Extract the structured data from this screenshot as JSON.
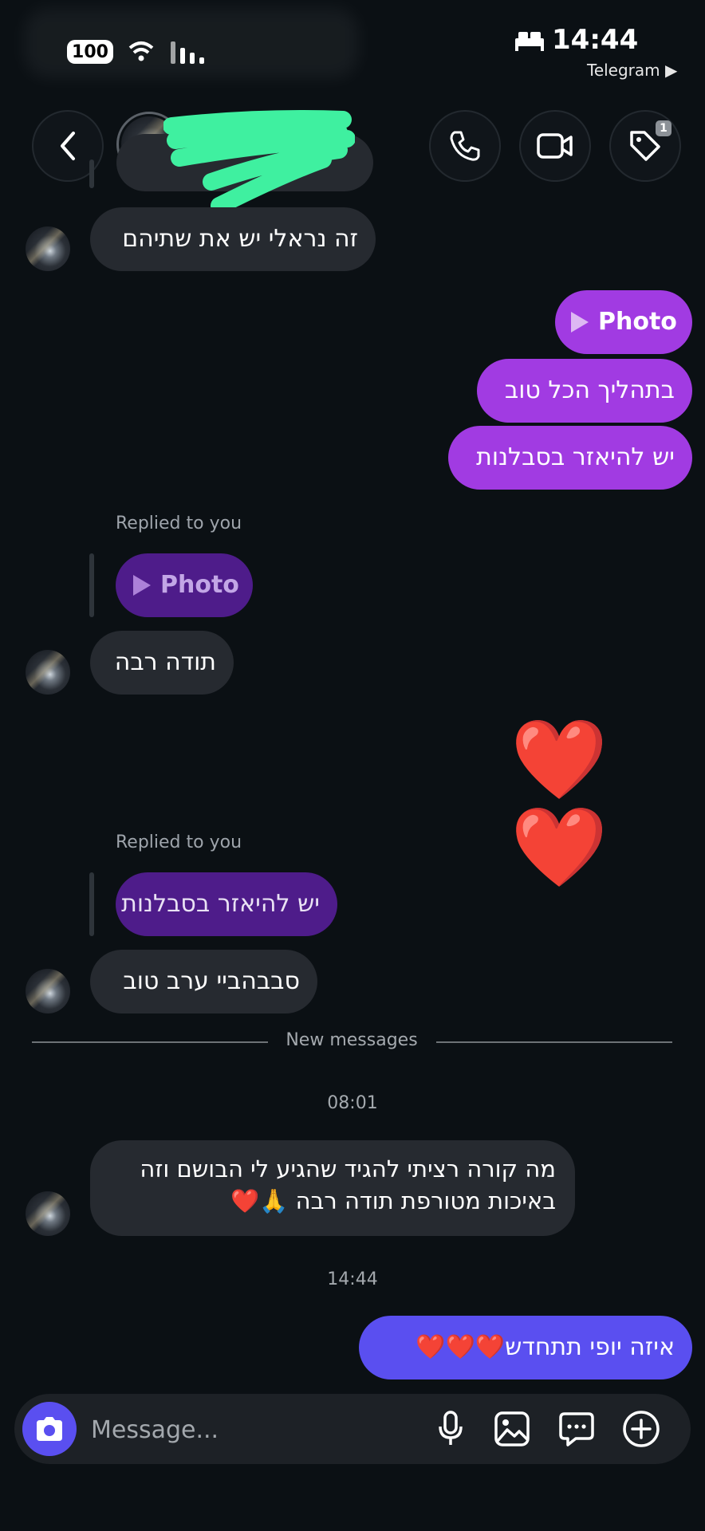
{
  "status_bar": {
    "time": "14:44",
    "battery": "100",
    "back_app": "Telegram ▶"
  },
  "header": {
    "notification_badge": "1"
  },
  "messages": {
    "m1": "זה נראלי יש את שתיהם",
    "out_photo": "Photo",
    "out_1": "בתהליך הכל טוב",
    "out_2": "יש להיאזר בסבלנות",
    "replied_label_1": "Replied to you",
    "reply_photo": "Photo",
    "m2": "תודה רבה",
    "hearts": "❤️❤️",
    "replied_label_2": "Replied to you",
    "reply_text": "יש להיאזר בסבלנות",
    "m3": "סבבהביי ערב טוב",
    "new_messages": "New messages",
    "time_1": "08:01",
    "m4_line1": "מה קורה רציתי להגיד שהגיע לי הבושם וזה",
    "m4_line2": "באיכות מטורפת תודה רבה 🙏❤️",
    "time_2": "14:44",
    "out_3": "איזה יופי תתחדש❤️❤️❤️"
  },
  "composer": {
    "placeholder": "Message..."
  },
  "colors": {
    "accent": "#5a4ff0",
    "outgoing": "#a13be2",
    "incoming": "#262a30"
  }
}
